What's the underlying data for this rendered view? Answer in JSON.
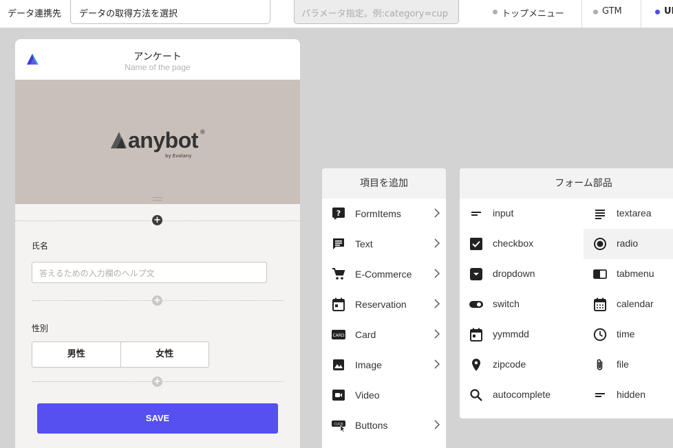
{
  "topbar": {
    "source_label": "データ連携先",
    "source_select": "データの取得方法を選択",
    "param_placeholder": "パラメータ指定。例:category=cup",
    "tabs": [
      "トップメニュー",
      "GTM",
      "URL"
    ]
  },
  "preview": {
    "page_title": "アンケート",
    "page_subtitle": "Name of the page",
    "brand": {
      "name": "anybot",
      "reg": "®",
      "by": "by Evolany"
    },
    "fields": [
      {
        "label": "氏名",
        "placeholder": "答えるための入力欄のヘルプ文"
      },
      {
        "label": "性別",
        "options": [
          "男性",
          "女性"
        ]
      }
    ],
    "save_label": "SAVE"
  },
  "add_panel": {
    "title": "項目を追加",
    "items": [
      {
        "label": "FormItems",
        "icon": "question-box-icon"
      },
      {
        "label": "Text",
        "icon": "message-icon"
      },
      {
        "label": "E-Commerce",
        "icon": "cart-icon"
      },
      {
        "label": "Reservation",
        "icon": "calendar-icon"
      },
      {
        "label": "Card",
        "icon": "card-icon"
      },
      {
        "label": "Image",
        "icon": "image-icon"
      },
      {
        "label": "Video",
        "icon": "video-icon"
      },
      {
        "label": "Buttons",
        "icon": "click-button-icon"
      }
    ]
  },
  "parts_panel": {
    "title": "フォーム部品",
    "left": [
      {
        "label": "input",
        "icon": "short-text-icon"
      },
      {
        "label": "checkbox",
        "icon": "checkbox-icon"
      },
      {
        "label": "dropdown",
        "icon": "dropdown-icon"
      },
      {
        "label": "switch",
        "icon": "toggle-icon"
      },
      {
        "label": "yymmdd",
        "icon": "date-icon"
      },
      {
        "label": "zipcode",
        "icon": "location-pin-icon"
      },
      {
        "label": "autocomplete",
        "icon": "search-icon"
      }
    ],
    "right": [
      {
        "label": "textarea",
        "icon": "paragraph-icon"
      },
      {
        "label": "radio",
        "icon": "radio-icon"
      },
      {
        "label": "tabmenu",
        "icon": "tab-icon"
      },
      {
        "label": "calendar",
        "icon": "calendar-icon"
      },
      {
        "label": "time",
        "icon": "clock-icon"
      },
      {
        "label": "file",
        "icon": "paperclip-icon"
      },
      {
        "label": "hidden",
        "icon": "hidden-field-icon"
      }
    ]
  },
  "colors": {
    "accent": "#5550ef",
    "banner": "#c9c0ba",
    "canvas": "#d3d3d3"
  }
}
